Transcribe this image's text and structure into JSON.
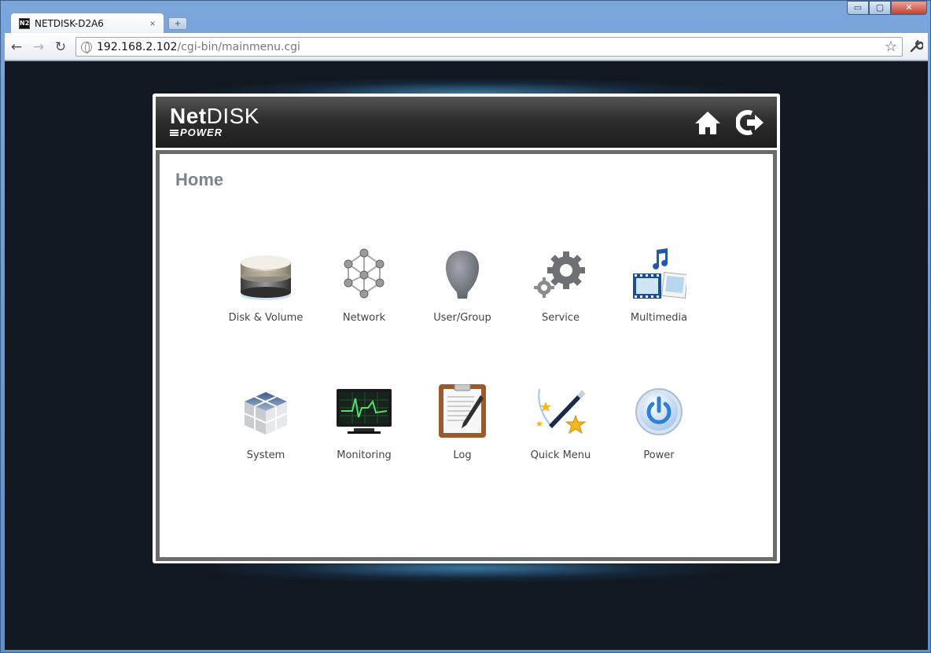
{
  "browser": {
    "tab_title": "NETDISK-D2A6",
    "tab_favicon_text": "N2",
    "tab_close": "×",
    "new_tab": "+",
    "window_buttons": {
      "minimize": "▭",
      "maximize": "▢",
      "close": "✕"
    },
    "nav": {
      "back": "←",
      "forward": "→",
      "reload": "↻"
    },
    "url_host": "192.168.2.102",
    "url_path": "/cgi-bin/mainmenu.cgi",
    "bookmark": "☆",
    "wrench": "🔧"
  },
  "app": {
    "logo_net": "Net",
    "logo_disk": "DISK",
    "logo_sub": "POWER",
    "page_title": "Home",
    "menu": [
      {
        "label": "Disk & Volume",
        "icon": "disk-volume-icon"
      },
      {
        "label": "Network",
        "icon": "network-icon"
      },
      {
        "label": "User/Group",
        "icon": "user-group-icon"
      },
      {
        "label": "Service",
        "icon": "gears-icon"
      },
      {
        "label": "Multimedia",
        "icon": "multimedia-icon"
      },
      {
        "label": "System",
        "icon": "cubes-icon"
      },
      {
        "label": "Monitoring",
        "icon": "monitor-icon"
      },
      {
        "label": "Log",
        "icon": "clipboard-icon"
      },
      {
        "label": "Quick Menu",
        "icon": "magic-wand-icon"
      },
      {
        "label": "Power",
        "icon": "power-icon"
      }
    ]
  },
  "colors": {
    "page_background": "#111820",
    "glow": "#5abeff",
    "header_dark": "#1d1d1d",
    "title_gray": "#7b8391"
  }
}
